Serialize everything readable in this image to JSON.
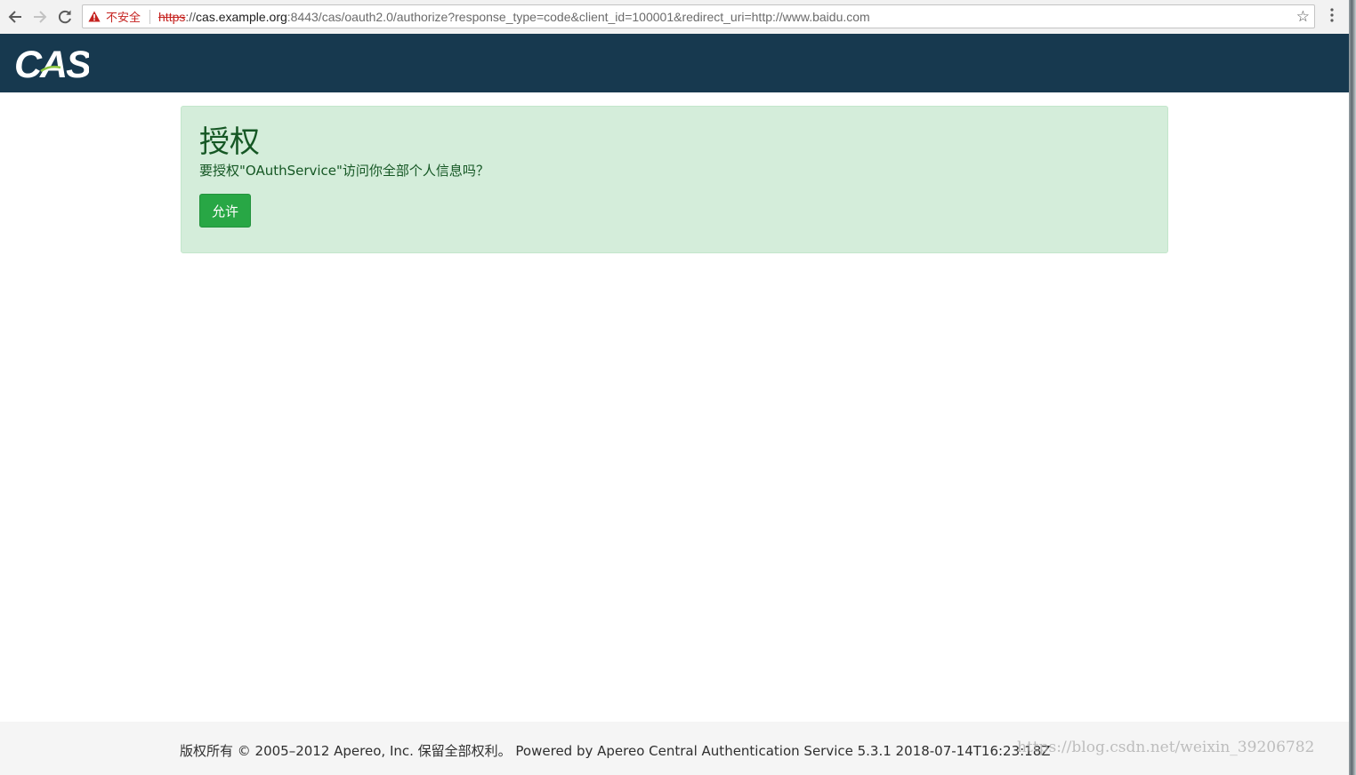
{
  "browser": {
    "security_label": "不安全",
    "url_scheme": "https",
    "url_scheme_sep": "://",
    "url_host": "cas.example.org",
    "url_rest": ":8443/cas/oauth2.0/authorize?response_type=code&client_id=100001&redirect_uri=http://www.baidu.com",
    "icons": [
      "back-arrow-icon",
      "forward-arrow-icon",
      "reload-icon",
      "warning-triangle-icon",
      "bookmark-star-icon",
      "menu-kebab-icon"
    ]
  },
  "header": {
    "logo_text": "CAS"
  },
  "auth": {
    "title": "授权",
    "prompt": "要授权\"OAuthService\"访问你全部个人信息吗？",
    "allow_label": "允许"
  },
  "footer": {
    "text": "版权所有 © 2005–2012 Apereo, Inc. 保留全部权利。 Powered by Apereo Central Authentication Service 5.3.1 2018-07-14T16:23:18Z"
  },
  "watermark": "https://blog.csdn.net/weixin_39206782",
  "colors": {
    "header_bg": "#17394f",
    "panel_bg": "#d4edda",
    "panel_text": "#155724",
    "button_bg": "#28a745",
    "insecure_red": "#c5221f"
  }
}
